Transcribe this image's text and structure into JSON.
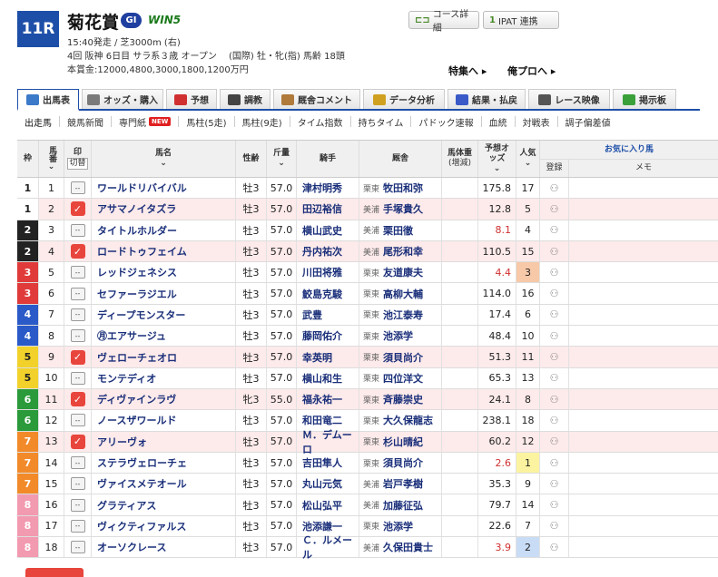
{
  "race": {
    "number": "11R",
    "name": "菊花賞",
    "grade": "GI",
    "win5": "WIN5",
    "info_line1": "15:40発走 / 芝3000m (右)",
    "info_line2": "4回 阪神 6日目 サラ系３歳 オープン　 (国際) 牡・牝(指) 馬齢 18頭",
    "info_line3": "本賞金:12000,4800,3000,1800,1200万円",
    "course_btn": "コース詳細",
    "ipat_btn": "IPAT 連携",
    "ipat_icon": "1",
    "special_link": "特集へ",
    "yopro_link": "俺プロへ"
  },
  "tabs": [
    {
      "label": "出馬表",
      "color": "#3a7ac8"
    },
    {
      "label": "オッズ・購入",
      "color": "#7a7a7a"
    },
    {
      "label": "予想",
      "color": "#d03030"
    },
    {
      "label": "調教",
      "color": "#444444"
    },
    {
      "label": "厩舎コメント",
      "color": "#b07a3a"
    },
    {
      "label": "データ分析",
      "color": "#d0a020"
    },
    {
      "label": "結果・払戻",
      "color": "#3a5ac8"
    },
    {
      "label": "レース映像",
      "color": "#555555"
    },
    {
      "label": "掲示板",
      "color": "#3aa03a"
    }
  ],
  "subtabs": [
    "出走馬",
    "競馬新聞",
    "専門紙",
    "馬柱(5走)",
    "馬柱(9走)",
    "タイム指数",
    "持ちタイム",
    "パドック速報",
    "血統",
    "対戦表",
    "調子偏差値"
  ],
  "new_badge": "NEW",
  "headers": {
    "waku": "枠",
    "uma": "馬番",
    "mark": "印",
    "mark_sub": "切替",
    "name": "馬名",
    "sex": "性齢",
    "kin": "斤量",
    "jockey": "騎手",
    "trainer": "厩舎",
    "weight": "馬体重",
    "weight_sub": "(増減)",
    "odds": "予想オッズ",
    "pop": "人気",
    "reg": "登録",
    "fav": "お気に入り馬",
    "memo": "メモ"
  },
  "horses": [
    {
      "waku": "1",
      "uma": "1",
      "mark": "--",
      "name": "ワールドリバイバル",
      "sex": "牡3",
      "kin": "57.0",
      "jockey": "津村明秀",
      "loc": "栗東",
      "trainer": "牧田和弥",
      "odds": "175.8",
      "pop": "17"
    },
    {
      "waku": "1",
      "uma": "2",
      "mark": "check",
      "name": "アサマノイタズラ",
      "sex": "牡3",
      "kin": "57.0",
      "jockey": "田辺裕信",
      "loc": "美浦",
      "trainer": "手塚貴久",
      "odds": "12.8",
      "pop": "5"
    },
    {
      "waku": "2",
      "uma": "3",
      "mark": "--",
      "name": "タイトルホルダー",
      "sex": "牡3",
      "kin": "57.0",
      "jockey": "横山武史",
      "loc": "美浦",
      "trainer": "栗田徹",
      "odds": "8.1",
      "pop": "4"
    },
    {
      "waku": "2",
      "uma": "4",
      "mark": "check",
      "name": "ロードトゥフェイム",
      "sex": "牡3",
      "kin": "57.0",
      "jockey": "丹内祐次",
      "loc": "美浦",
      "trainer": "尾形和幸",
      "odds": "110.5",
      "pop": "15"
    },
    {
      "waku": "3",
      "uma": "5",
      "mark": "--",
      "name": "レッドジェネシス",
      "sex": "牡3",
      "kin": "57.0",
      "jockey": "川田将雅",
      "loc": "栗東",
      "trainer": "友道康夫",
      "odds": "4.4",
      "pop": "3"
    },
    {
      "waku": "3",
      "uma": "6",
      "mark": "--",
      "name": "セファーラジエル",
      "sex": "牡3",
      "kin": "57.0",
      "jockey": "鮫島克駿",
      "loc": "栗東",
      "trainer": "高柳大輔",
      "odds": "114.0",
      "pop": "16"
    },
    {
      "waku": "4",
      "uma": "7",
      "mark": "--",
      "name": "ディープモンスター",
      "sex": "牡3",
      "kin": "57.0",
      "jockey": "武豊",
      "loc": "栗東",
      "trainer": "池江泰寿",
      "odds": "17.4",
      "pop": "6"
    },
    {
      "waku": "4",
      "uma": "8",
      "mark": "--",
      "name": "㊊エアサージュ",
      "sex": "牡3",
      "kin": "57.0",
      "jockey": "藤岡佑介",
      "loc": "栗東",
      "trainer": "池添学",
      "odds": "48.4",
      "pop": "10"
    },
    {
      "waku": "5",
      "uma": "9",
      "mark": "check",
      "name": "ヴェローチェオロ",
      "sex": "牡3",
      "kin": "57.0",
      "jockey": "幸英明",
      "loc": "栗東",
      "trainer": "須貝尚介",
      "odds": "51.3",
      "pop": "11"
    },
    {
      "waku": "5",
      "uma": "10",
      "mark": "--",
      "name": "モンテディオ",
      "sex": "牡3",
      "kin": "57.0",
      "jockey": "横山和生",
      "loc": "栗東",
      "trainer": "四位洋文",
      "odds": "65.3",
      "pop": "13"
    },
    {
      "waku": "6",
      "uma": "11",
      "mark": "check",
      "name": "ディヴァインラヴ",
      "sex": "牝3",
      "kin": "55.0",
      "jockey": "福永祐一",
      "loc": "栗東",
      "trainer": "斉藤崇史",
      "odds": "24.1",
      "pop": "8"
    },
    {
      "waku": "6",
      "uma": "12",
      "mark": "--",
      "name": "ノースザワールド",
      "sex": "牡3",
      "kin": "57.0",
      "jockey": "和田竜二",
      "loc": "栗東",
      "trainer": "大久保龍志",
      "odds": "238.1",
      "pop": "18"
    },
    {
      "waku": "7",
      "uma": "13",
      "mark": "check",
      "name": "アリーヴォ",
      "sex": "牡3",
      "kin": "57.0",
      "jockey": "Ｍ．デムーロ",
      "loc": "栗東",
      "trainer": "杉山晴紀",
      "odds": "60.2",
      "pop": "12"
    },
    {
      "waku": "7",
      "uma": "14",
      "mark": "--",
      "name": "ステラヴェローチェ",
      "sex": "牡3",
      "kin": "57.0",
      "jockey": "吉田隼人",
      "loc": "栗東",
      "trainer": "須貝尚介",
      "odds": "2.6",
      "pop": "1"
    },
    {
      "waku": "7",
      "uma": "15",
      "mark": "--",
      "name": "ヴァイスメテオール",
      "sex": "牡3",
      "kin": "57.0",
      "jockey": "丸山元気",
      "loc": "美浦",
      "trainer": "岩戸孝樹",
      "odds": "35.3",
      "pop": "9"
    },
    {
      "waku": "8",
      "uma": "16",
      "mark": "--",
      "name": "グラティアス",
      "sex": "牡3",
      "kin": "57.0",
      "jockey": "松山弘平",
      "loc": "美浦",
      "trainer": "加藤征弘",
      "odds": "79.7",
      "pop": "14"
    },
    {
      "waku": "8",
      "uma": "17",
      "mark": "--",
      "name": "ヴィクティファルス",
      "sex": "牡3",
      "kin": "57.0",
      "jockey": "池添謙一",
      "loc": "栗東",
      "trainer": "池添学",
      "odds": "22.6",
      "pop": "7"
    },
    {
      "waku": "8",
      "uma": "18",
      "mark": "--",
      "name": "オーソクレース",
      "sex": "牡3",
      "kin": "57.0",
      "jockey": "Ｃ．ルメール",
      "loc": "美浦",
      "trainer": "久保田貴士",
      "odds": "3.9",
      "pop": "2"
    }
  ],
  "waku_colors": {
    "1": {
      "bg": "#ffffff",
      "fg": "#222222"
    },
    "2": {
      "bg": "#222222",
      "fg": "#ffffff"
    },
    "3": {
      "bg": "#e03a3a",
      "fg": "#ffffff"
    },
    "4": {
      "bg": "#2a5ac8",
      "fg": "#ffffff"
    },
    "5": {
      "bg": "#f2d22a",
      "fg": "#222222"
    },
    "6": {
      "bg": "#2a9a3a",
      "fg": "#ffffff"
    },
    "7": {
      "bg": "#f28a2a",
      "fg": "#ffffff"
    },
    "8": {
      "bg": "#f29ab0",
      "fg": "#ffffff"
    }
  }
}
